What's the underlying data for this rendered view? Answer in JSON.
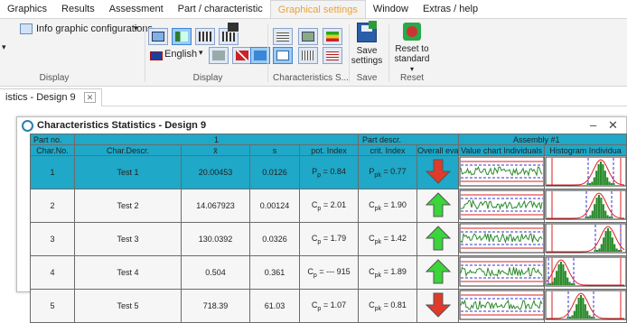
{
  "menu": {
    "items": [
      "Graphics",
      "Results",
      "Assessment",
      "Part / characteristic",
      "Graphical settings",
      "Window",
      "Extras / help"
    ]
  },
  "ribbon": {
    "info_graphic_label": "Info graphic configurations",
    "language_label": "English",
    "save_label_1": "Save",
    "save_label_2": "settings",
    "reset_label_1": "Reset to",
    "reset_label_2": "standard",
    "groups": {
      "display_1": "Display",
      "display_2": "Display",
      "characteristics": "Characteristics S...",
      "save": "Save",
      "reset": "Reset"
    }
  },
  "doc_tab": {
    "label": "istics - Design 9"
  },
  "window": {
    "title": "Characteristics Statistics - Design 9",
    "part_no_label": "Part no.",
    "part_no_value": "1",
    "part_descr_label": "Part descr.",
    "part_descr_value": "Assembly #1",
    "columns": [
      "Char.No.",
      "Char.Descr.",
      "x̄",
      "s",
      "pot. Index",
      "crit. Index",
      "Overall evalu",
      "Value chart Individuals",
      "Histogram Individua"
    ],
    "rows": [
      {
        "no": "1",
        "descr": "Test 1",
        "mean": "20.00453",
        "s": "0.0126",
        "pot_sym": "P",
        "pot_sub": "p",
        "pot_val": "0.84",
        "crit_sym": "P",
        "crit_sub": "pk",
        "crit_val": "0.77",
        "eval": "down"
      },
      {
        "no": "2",
        "descr": "Test 2",
        "mean": "14.067923",
        "s": "0.00124",
        "pot_sym": "C",
        "pot_sub": "p",
        "pot_val": "2.01",
        "crit_sym": "C",
        "crit_sub": "pk",
        "crit_val": "1.90",
        "eval": "up"
      },
      {
        "no": "3",
        "descr": "Test 3",
        "mean": "130.0392",
        "s": "0.0326",
        "pot_sym": "C",
        "pot_sub": "p",
        "pot_val": "1.79",
        "crit_sym": "C",
        "crit_sub": "pk",
        "crit_val": "1.42",
        "eval": "up"
      },
      {
        "no": "4",
        "descr": "Test 4",
        "mean": "0.504",
        "s": "0.361",
        "pot_sym": "C",
        "pot_sub": "p",
        "pot_val": "--- 915",
        "crit_sym": "C",
        "crit_sub": "pk",
        "crit_val": "1.89",
        "eval": "up"
      },
      {
        "no": "5",
        "descr": "Test 5",
        "mean": "718.39",
        "s": "61.03",
        "pot_sym": "C",
        "pot_sub": "p",
        "pot_val": "1.07",
        "crit_sym": "C",
        "crit_sub": "pk",
        "crit_val": "0.81",
        "eval": "down"
      }
    ]
  },
  "colors": {
    "accent": "#1fa8c8",
    "up": "#3bd43b",
    "down": "#e03a2a"
  }
}
